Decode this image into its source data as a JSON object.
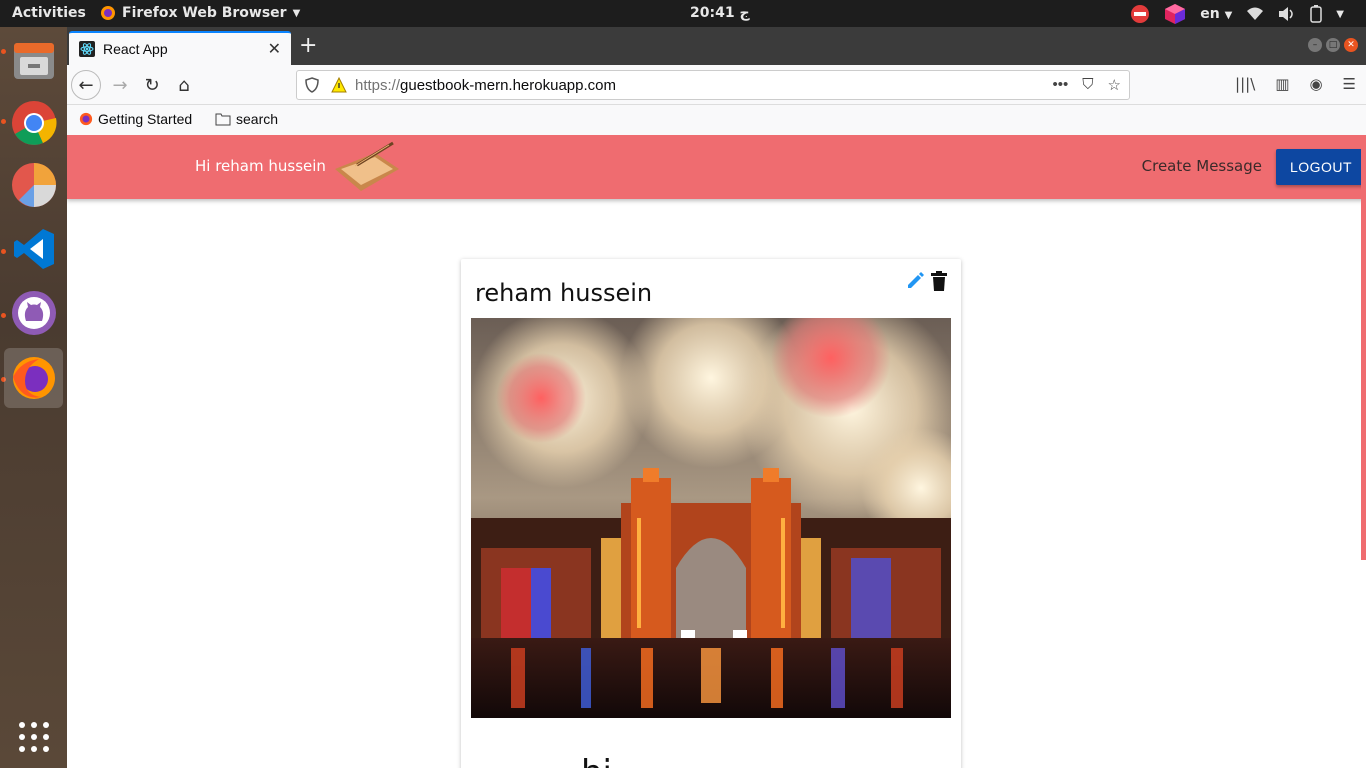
{
  "system_bar": {
    "activities": "Activities",
    "app_name": "Firefox Web Browser",
    "clock": "20:41 ج",
    "lang": "en"
  },
  "browser": {
    "tab_title": "React App",
    "url_protocol": "https://",
    "url_host": "guestbook-mern.herokuapp.com",
    "bookmarks": [
      "Getting Started",
      "search"
    ]
  },
  "app": {
    "greeting": "Hi reham hussein",
    "nav_link": "Create Message",
    "logout_label": "LOGOUT",
    "accent_color": "#ef6c70",
    "button_color": "#0d47a1"
  },
  "message": {
    "author": "reham hussein",
    "text_partial": "hi"
  }
}
